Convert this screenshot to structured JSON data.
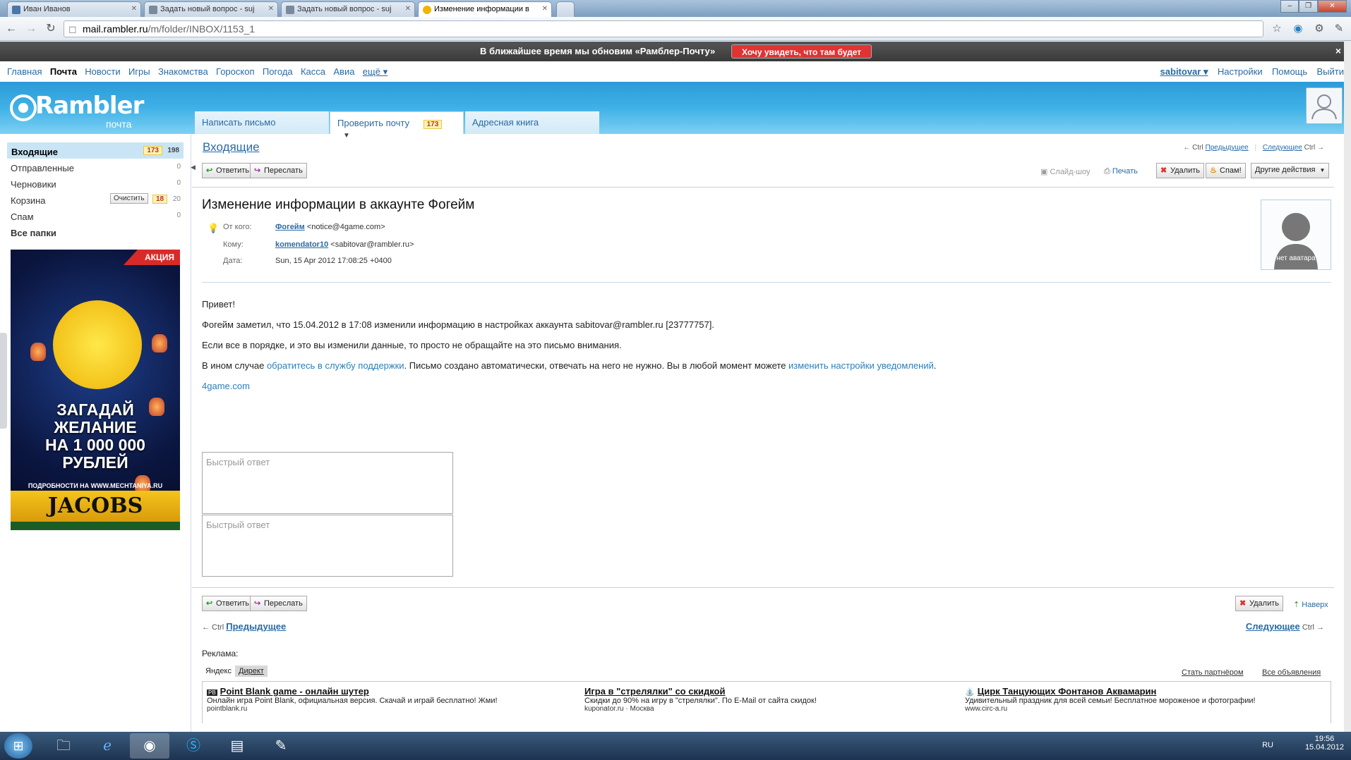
{
  "browser": {
    "tabs": [
      {
        "label": "Иван Иванов",
        "icon_color": "#4a76a8"
      },
      {
        "label": "Задать новый вопрос - suj",
        "icon_color": "#7a8a9a"
      },
      {
        "label": "Задать новый вопрос - suj",
        "icon_color": "#7a8a9a"
      },
      {
        "label": "Изменение информации в",
        "icon_color": "#f2b400"
      }
    ],
    "url_host": "mail.rambler.ru",
    "url_path": "/m/folder/INBOX/1153_1"
  },
  "notice": {
    "text": "В ближайшее время мы обновим «Рамблер-Почту»",
    "button": "Хочу увидеть, что там будет",
    "close": "×"
  },
  "topmenu": {
    "items": [
      "Главная",
      "Почта",
      "Новости",
      "Игры",
      "Знакомства",
      "Гороскоп",
      "Погода",
      "Касса",
      "Авиа",
      "ещё ▾"
    ],
    "user": "sabitovar ▾",
    "settings": "Настройки",
    "help": "Помощь",
    "logout": "Выйти"
  },
  "header": {
    "logo": "Rambler",
    "logo_sub": "почта",
    "tabs": {
      "compose": "Написать письмо",
      "check": "Проверить почту",
      "check_count": "173",
      "addressbook": "Адресная книга"
    }
  },
  "sidebar": {
    "folders": [
      {
        "label": "Входящие",
        "unread": "173",
        "total": "198"
      },
      {
        "label": "Отправленные",
        "total": "0"
      },
      {
        "label": "Черновики",
        "total": "0"
      },
      {
        "label": "Корзина",
        "clean": "Очистить",
        "unread": "18",
        "total": "20"
      },
      {
        "label": "Спам",
        "total": "0"
      }
    ],
    "all_folders": "Все папки"
  },
  "banner": {
    "badge": "АКЦИЯ",
    "wish_lines": [
      "ЗАГАДАЙ",
      "ЖЕЛАНИЕ",
      "НА 1 000 000",
      "РУБЛЕЙ"
    ],
    "details": "ПОДРОБНОСТИ НА WWW.MECHTANIYA.RU",
    "brand": "JACOBS"
  },
  "main": {
    "folder_title": "Входящие",
    "prev_hint": "← Ctrl",
    "prev": "Предыдущее",
    "next": "Следующее",
    "next_hint": "Ctrl →",
    "reply": "Ответить",
    "forward": "Переслать",
    "slideshow": "Слайд-шоу",
    "print": "Печать",
    "delete": "Удалить",
    "spam": "Спам!",
    "more": "Другие действия",
    "subject": "Изменение информации в аккаунте Фогейм",
    "from_label": "От кого:",
    "from_name": "Фогейм",
    "from_email": "<notice@4game.com>",
    "to_label": "Кому:",
    "to_name": "komendator10",
    "to_email": "<sabitovar@rambler.ru>",
    "date_label": "Дата:",
    "date": "Sun, 15 Apr 2012 17:08:25 +0400",
    "no_avatar": "нет аватара",
    "body": {
      "greeting": "Привет!",
      "line1": "Фогейм заметил, что 15.04.2012 в 17:08 изменили информацию в настройках аккаунта sabitovar@rambler.ru [23777757].",
      "line2": "Если все в порядке, и это вы изменили данные, то просто не обращайте на это письмо внимания.",
      "line3_pre": "В ином случае ",
      "line3_link1": "обратитесь в службу поддержки",
      "line3_mid": ". Письмо создано автоматически, отвечать на него не нужно. Вы в любой момент можете ",
      "line3_link2": "изменить настройки уведомлений",
      "line3_end": ".",
      "site": "4game.com"
    },
    "quick_reply_placeholder": "Быстрый ответ",
    "up": "Наверх"
  },
  "ads": {
    "header": "Реклама:",
    "tab_yandex": "Яндекс",
    "tab_direct": "Директ",
    "become_partner": "Стать партнёром",
    "all_ads": "Все объявления",
    "items": [
      {
        "title": "Point Blank game - онлайн шутер",
        "text": "Онлайн игра Point Blank, официальная версия. Скачай и играй бесплатно! Жми!",
        "url": "pointblank.ru"
      },
      {
        "title": "Игра в \"стрелялки\" со скидкой",
        "text": "Скидки до 90% на игру в \"стрелялки\". По E-Mail от сайта скидок!",
        "url": "kuponator.ru  ·  Москва"
      },
      {
        "title": "Цирк Танцующих Фонтанов Аквамарин",
        "text": "Удивительный праздник для всей семьи! Бесплатное мороженое и фотографии!",
        "url": "www.circ-a.ru"
      }
    ]
  },
  "taskbar": {
    "lang": "RU",
    "time": "19:56",
    "date": "15.04.2012"
  }
}
